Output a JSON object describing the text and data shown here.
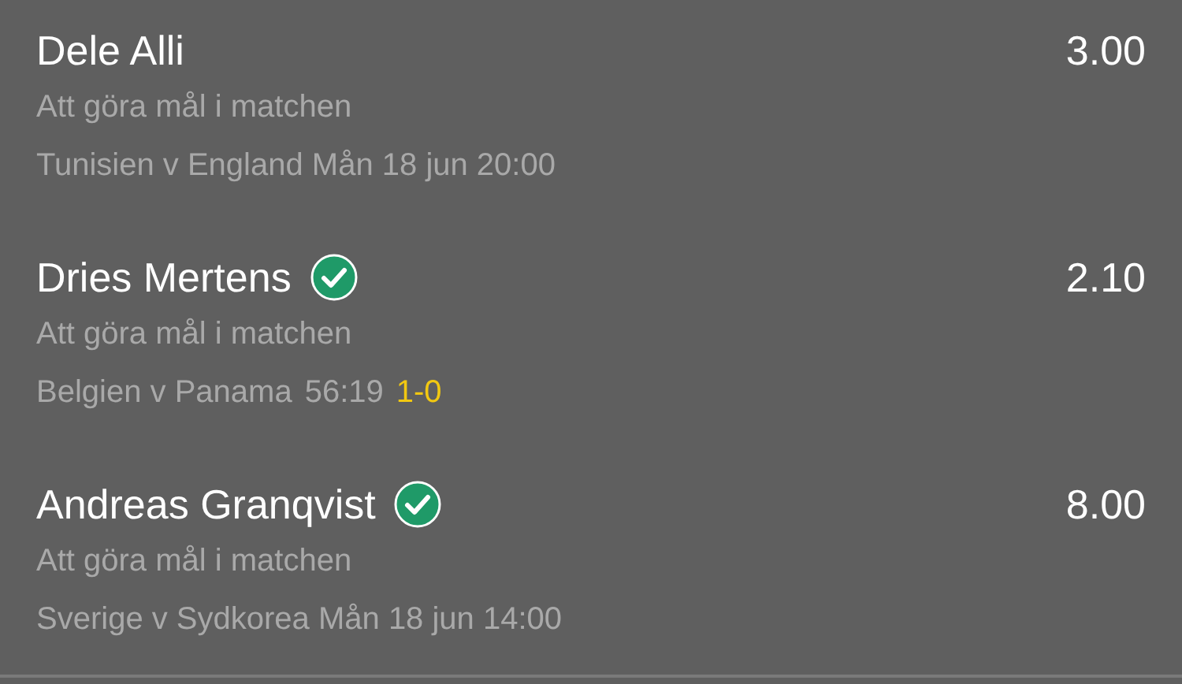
{
  "bets": [
    {
      "name": "Dele Alli",
      "won": false,
      "odds": "3.00",
      "market": "Att göra mål i matchen",
      "match": "Tunisien v England Mån 18 jun 20:00"
    },
    {
      "name": "Dries Mertens",
      "won": true,
      "odds": "2.10",
      "market": "Att göra mål i matchen",
      "match": "Belgien v Panama",
      "clock": "56:19",
      "score": "1-0"
    },
    {
      "name": "Andreas Granqvist",
      "won": true,
      "odds": "8.00",
      "market": "Att göra mål i matchen",
      "match": "Sverige v Sydkorea Mån 18 jun 14:00"
    }
  ]
}
